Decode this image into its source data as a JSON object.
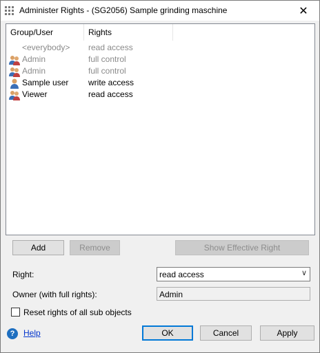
{
  "window": {
    "title": "Administer Rights - (SG2056) Sample grinding maschine"
  },
  "list": {
    "columns": [
      "Group/User",
      "Rights"
    ],
    "rows": [
      {
        "user": "<everybody>",
        "right": "read access",
        "inherited": true,
        "icon": "none"
      },
      {
        "user": "Admin",
        "right": "full control",
        "inherited": true,
        "icon": "group-icon"
      },
      {
        "user": "Admin",
        "right": "full control",
        "inherited": true,
        "icon": "group-icon"
      },
      {
        "user": "Sample user",
        "right": "write access",
        "inherited": false,
        "icon": "user-icon"
      },
      {
        "user": "Viewer",
        "right": "read access",
        "inherited": false,
        "icon": "group-icon"
      }
    ]
  },
  "buttons": {
    "add": "Add",
    "remove": "Remove",
    "show_effective": "Show Effective Right",
    "ok": "OK",
    "cancel": "Cancel",
    "apply": "Apply"
  },
  "form": {
    "right_label": "Right:",
    "right_value": "read access",
    "owner_label": "Owner (with full rights):",
    "owner_value": "Admin",
    "reset_label": "Reset rights of all sub objects",
    "reset_checked": false
  },
  "help": {
    "label": "Help"
  },
  "colors": {
    "accent": "#0078d7",
    "link": "#0033cc",
    "inherited_text": "#8a8a8a"
  }
}
